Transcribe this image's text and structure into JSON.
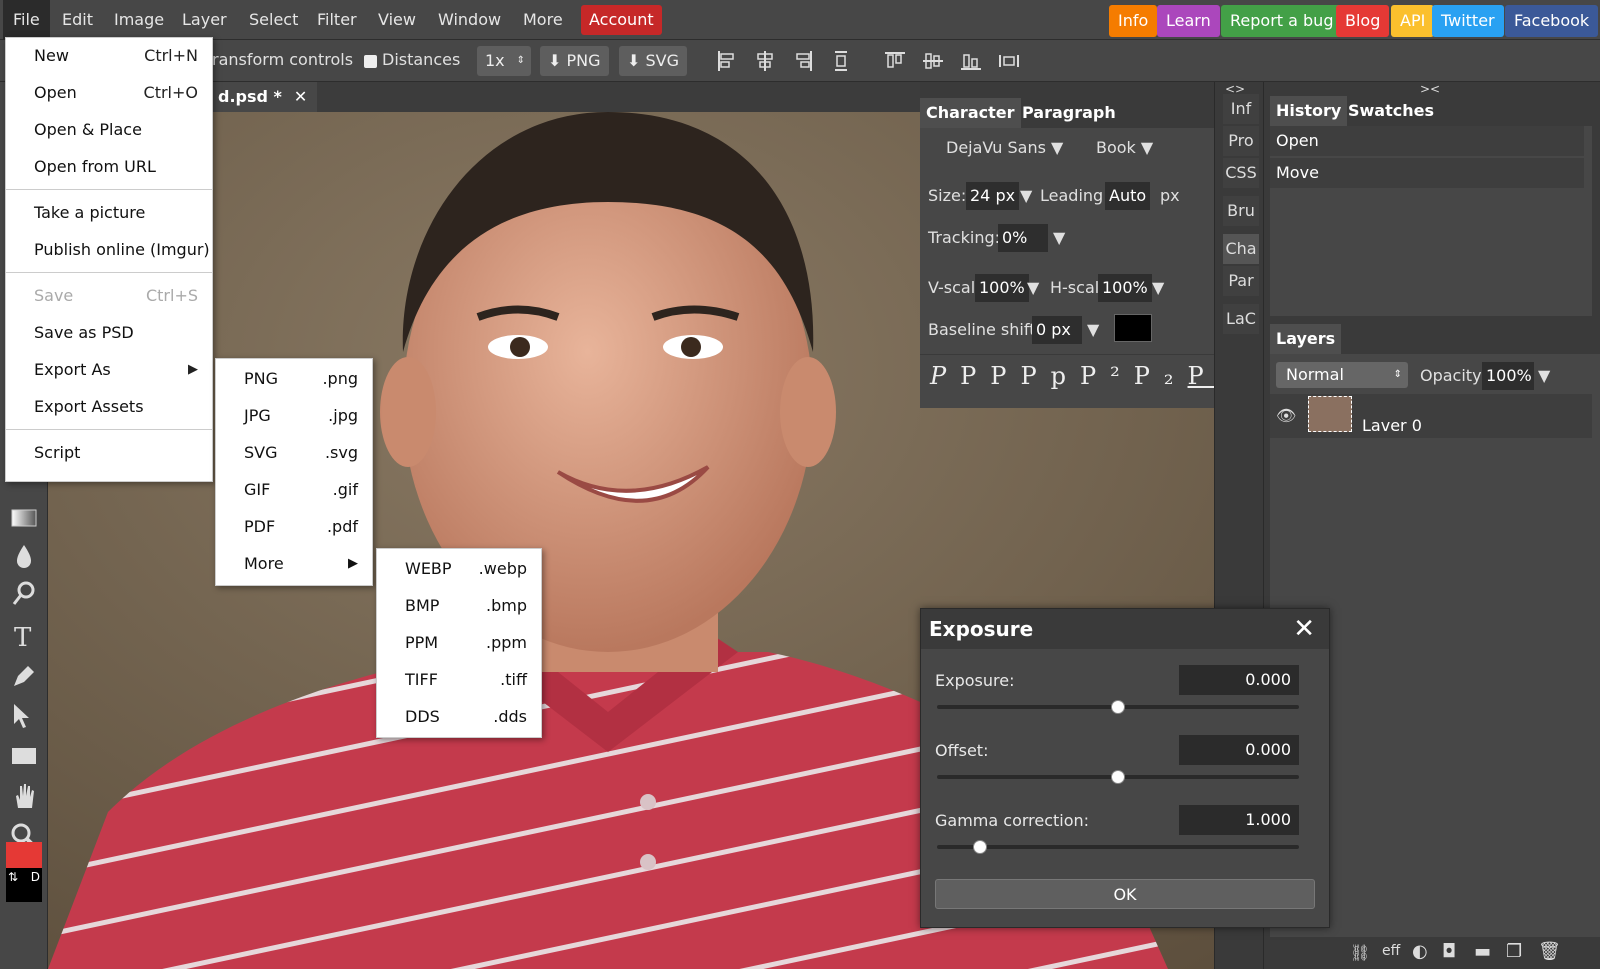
{
  "menubar": {
    "items": [
      "File",
      "Edit",
      "Image",
      "Layer",
      "Select",
      "Filter",
      "View",
      "Window",
      "More"
    ],
    "account": "Account",
    "external": [
      {
        "label": "Info",
        "color": "#f57c00"
      },
      {
        "label": "Learn",
        "color": "#ab47bc"
      },
      {
        "label": "Report a bug",
        "color": "#43a047"
      },
      {
        "label": "Blog",
        "color": "#e53935"
      },
      {
        "label": "API",
        "color": "#fbc02d"
      },
      {
        "label": "Twitter",
        "color": "#29a1f2"
      },
      {
        "label": "Facebook",
        "color": "#3b5998"
      }
    ]
  },
  "options": {
    "transform_controls": "ransform controls",
    "distances": "Distances",
    "scale": "1x",
    "png": "PNG",
    "svg": "SVG"
  },
  "document": {
    "tab_title": "d.psd *"
  },
  "character_panel": {
    "tabs": [
      "Character",
      "Paragraph"
    ],
    "font": "DejaVu Sans",
    "weight": "Book",
    "size_label": "Size:",
    "size": "24 px",
    "leading_label": "Leading:",
    "leading": "Auto",
    "leading_unit": "px",
    "tracking_label": "Tracking:",
    "tracking": "0%",
    "vscale_label": "V-scal",
    "vscale": "100%",
    "hscale_label": "H-scal",
    "hscale": "100%",
    "baseline_label": "Baseline shift:",
    "baseline": "0 px",
    "text_color": "#000000"
  },
  "mini_dock": [
    "Inf",
    "Pro",
    "CSS",
    "Bru",
    "Cha",
    "Par",
    "LaC"
  ],
  "history_panel": {
    "tabs": [
      "History",
      "Swatches"
    ],
    "entries": [
      "Open",
      "Move"
    ]
  },
  "layers_panel": {
    "title": "Layers",
    "blend_mode": "Normal",
    "opacity_label": "Opacity:",
    "opacity": "100%",
    "layer_name": "Laver 0"
  },
  "file_menu": {
    "items": [
      {
        "label": "New",
        "shortcut": "Ctrl+N"
      },
      {
        "label": "Open",
        "shortcut": "Ctrl+O"
      },
      {
        "label": "Open & Place",
        "shortcut": ""
      },
      {
        "label": "Open from URL",
        "shortcut": ""
      },
      {
        "label": "Take a picture",
        "shortcut": ""
      },
      {
        "label": "Publish online (Imgur)",
        "shortcut": ""
      },
      {
        "label": "Save",
        "shortcut": "Ctrl+S"
      },
      {
        "label": "Save as PSD",
        "shortcut": ""
      },
      {
        "label": "Export As",
        "shortcut": ""
      },
      {
        "label": "Export Assets",
        "shortcut": ""
      },
      {
        "label": "Script",
        "shortcut": ""
      }
    ]
  },
  "export_submenu": [
    {
      "label": "PNG",
      "ext": ".png"
    },
    {
      "label": "JPG",
      "ext": ".jpg"
    },
    {
      "label": "SVG",
      "ext": ".svg"
    },
    {
      "label": "GIF",
      "ext": ".gif"
    },
    {
      "label": "PDF",
      "ext": ".pdf"
    },
    {
      "label": "More",
      "ext": ""
    }
  ],
  "more_submenu": [
    {
      "label": "WEBP",
      "ext": ".webp"
    },
    {
      "label": "BMP",
      "ext": ".bmp"
    },
    {
      "label": "PPM",
      "ext": ".ppm"
    },
    {
      "label": "TIFF",
      "ext": ".tiff"
    },
    {
      "label": "DDS",
      "ext": ".dds"
    }
  ],
  "exposure_dialog": {
    "title": "Exposure",
    "exposure_label": "Exposure:",
    "exposure": "0.000",
    "exposure_level": 0.5,
    "offset_label": "Offset:",
    "offset": "0.000",
    "offset_level": 0.5,
    "gamma_label": "Gamma correction:",
    "gamma": "1.000",
    "gamma_level": 0.12,
    "ok": "OK"
  },
  "bottom_icons": [
    "link-icon",
    "eff",
    "half-circle-icon",
    "mask-icon",
    "folder-icon",
    "new-layer-icon",
    "trash-icon"
  ],
  "colors": {
    "foreground": "#e53935",
    "background": "#000000"
  }
}
